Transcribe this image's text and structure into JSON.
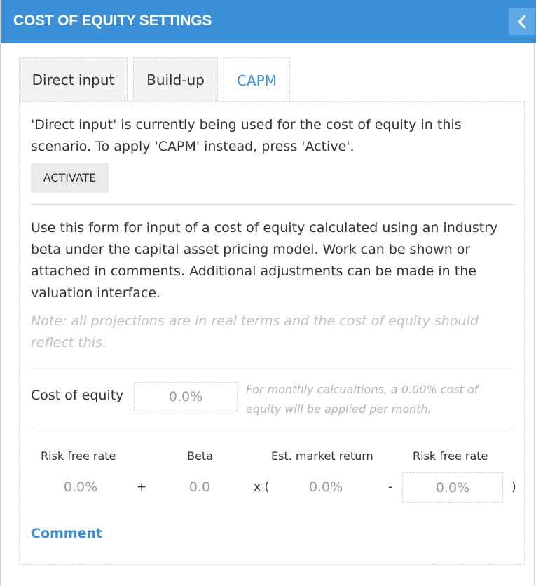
{
  "header": {
    "title": "COST OF EQUITY SETTINGS",
    "collapse_icon": "chevron-left-icon",
    "background": "#3a8fd6"
  },
  "tabs": [
    {
      "label": "Direct input",
      "active": false
    },
    {
      "label": "Build-up",
      "active": false
    },
    {
      "label": "CAPM",
      "active": true
    }
  ],
  "status": {
    "message": "'Direct input' is currently being used for the cost of equity in this scenario. To apply 'CAPM' instead, press 'Active'.",
    "activate_label": "ACTIVATE"
  },
  "description": {
    "text": "Use this form for input of a cost of equity calculated using an industry beta under the capital asset pricing model. Work can be shown or attached in comments. Additional adjustments can be made in the valuation interface.",
    "note": "Note: all projections are in real terms and the cost of equity should reflect this."
  },
  "cost_of_equity": {
    "label": "Cost of equity",
    "value": "0.0%",
    "hint": "For monthly calcualtions, a 0.00% cost of equity will be applied per month."
  },
  "capm": {
    "labels": {
      "risk_free_rate": "Risk free rate",
      "beta": "Beta",
      "market_return": "Est. market return",
      "risk_free_rate_2": "Risk free rate"
    },
    "values": {
      "risk_free_rate": "0.0%",
      "beta": "0.0",
      "market_return": "0.0%",
      "risk_free_rate_2": "0.0%"
    },
    "operators": {
      "plus": "+",
      "times_open": "x (",
      "minus": "-",
      "close": ")"
    }
  },
  "comment_label": "Comment",
  "accent_color": "#3a8fd6"
}
